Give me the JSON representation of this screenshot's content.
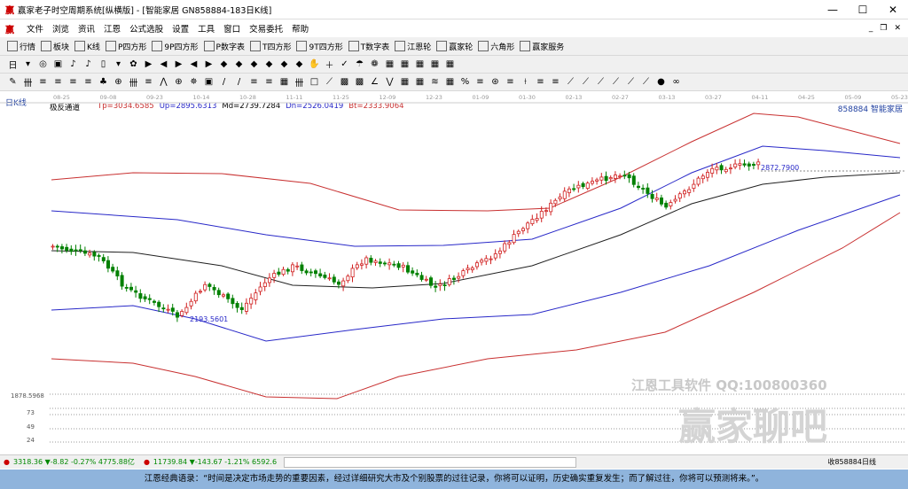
{
  "window": {
    "title": "赢家老子时空周期系统[纵横版] - [智能家居   GN858884-183日K线]",
    "logo": "赢",
    "minimize": "—",
    "maximize": "☐",
    "close": "✕"
  },
  "menu": [
    "文件",
    "浏览",
    "资讯",
    "江恩",
    "公式选股",
    "设置",
    "工具",
    "窗口",
    "交易委托",
    "帮助"
  ],
  "mdi": [
    "_",
    "❐",
    "✕"
  ],
  "toolbar": [
    "行情",
    "板块",
    "K线",
    "P四方形",
    "9P四方形",
    "P数字表",
    "T四方形",
    "9T四方形",
    "T数字表",
    "江恩轮",
    "赢家轮",
    "六角形",
    "赢家服务"
  ],
  "period": "日",
  "dates": [
    "08-25",
    "09-08",
    "09-23",
    "10-14",
    "10-28",
    "11-11",
    "11-25",
    "12-09",
    "12-23",
    "01-09",
    "01-30",
    "02-13",
    "02-27",
    "03-13",
    "03-27",
    "04-11",
    "04-25",
    "05-09",
    "05-23"
  ],
  "chart": {
    "ktitle": "日K线",
    "indicator": "极反通道",
    "tp": "Tp=3034.6585",
    "up": "Up=2895.6313",
    "md": "Md=2739.7284",
    "dn": "Dn=2526.0419",
    "bt": "Bt=2333.9064",
    "stock": "858884 智能家居",
    "high_label": "2872.7900",
    "low_label": "2193.5601",
    "min_axis": "1878.5968",
    "vol_ticks": [
      "73",
      "49",
      "24"
    ],
    "colors": {
      "red": "#c83030",
      "blue": "#2828c8",
      "black": "#202020",
      "up": "#d02020",
      "down": "#008000"
    }
  },
  "status": {
    "sh": "3318.36 ▼-8.82 -0.27% 4775.88亿",
    "sz": "11739.84 ▼-143.67 -1.21% 6592.6",
    "right": "收858884日线"
  },
  "watermark": {
    "line1": "江恩工具软件  QQ:100800360",
    "line2": "赢家聊吧"
  },
  "quote": "江恩经典语录：“时间是决定市场走势的重要因素，经过详细研究大市及个别股票的过往记录，你将可以证明，历史确实重复发生；而了解过往，你将可以预测将来。”。"
}
